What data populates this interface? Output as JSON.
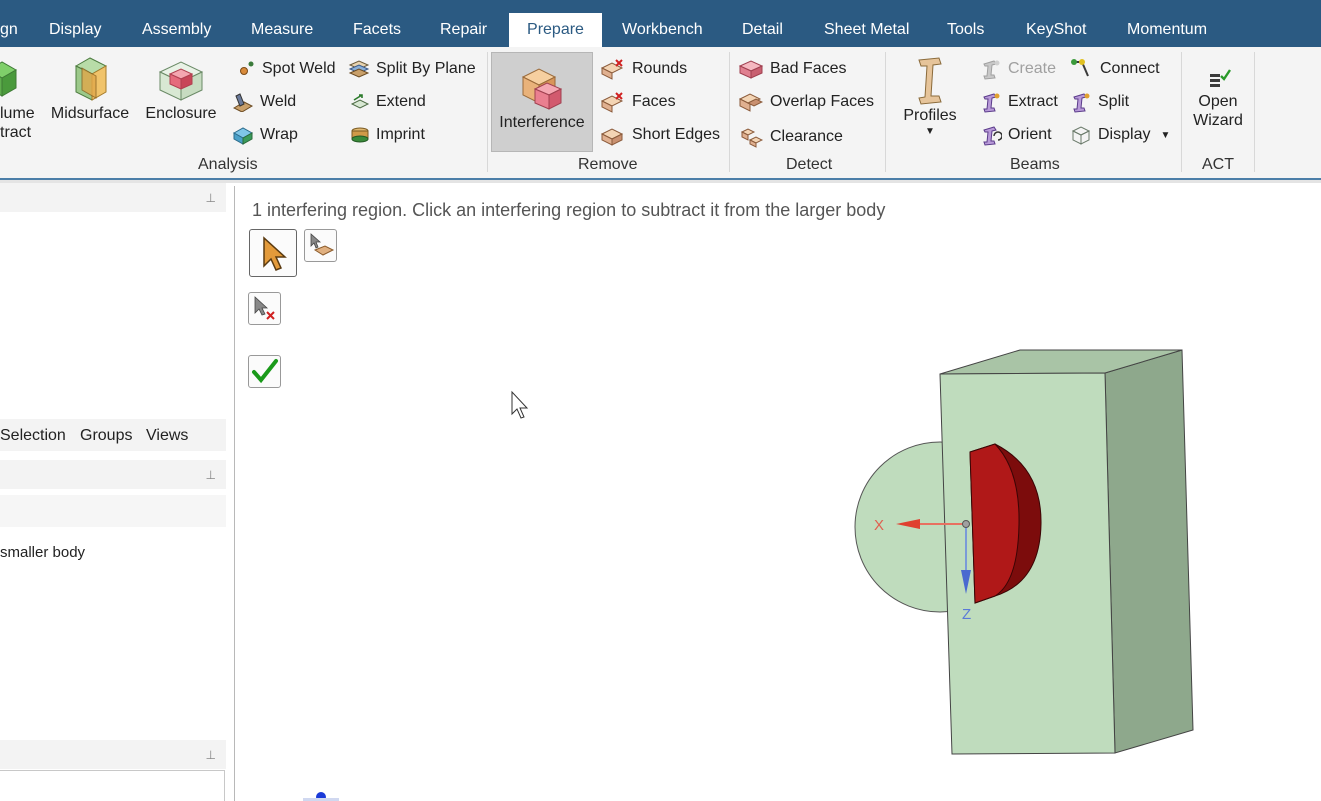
{
  "tabs": [
    {
      "label": "gn",
      "active": false
    },
    {
      "label": "Display",
      "active": false
    },
    {
      "label": "Assembly",
      "active": false
    },
    {
      "label": "Measure",
      "active": false
    },
    {
      "label": "Facets",
      "active": false
    },
    {
      "label": "Repair",
      "active": false
    },
    {
      "label": "Prepare",
      "active": true
    },
    {
      "label": "Workbench",
      "active": false
    },
    {
      "label": "Detail",
      "active": false
    },
    {
      "label": "Sheet Metal",
      "active": false
    },
    {
      "label": "Tools",
      "active": false
    },
    {
      "label": "KeyShot",
      "active": false
    },
    {
      "label": "Momentum",
      "active": false
    }
  ],
  "ribbon": {
    "analysis": {
      "label": "Analysis",
      "volume_extract_line1": "lume",
      "volume_extract_line2": "tract",
      "midsurface": "Midsurface",
      "enclosure": "Enclosure",
      "spot_weld": "Spot Weld",
      "weld": "Weld",
      "wrap": "Wrap",
      "split_by_plane": "Split By Plane",
      "extend": "Extend",
      "imprint": "Imprint"
    },
    "remove": {
      "label": "Remove",
      "interference": "Interference",
      "rounds": "Rounds",
      "faces": "Faces",
      "short_edges": "Short Edges"
    },
    "detect": {
      "label": "Detect",
      "bad_faces": "Bad Faces",
      "overlap_faces": "Overlap Faces",
      "clearance": "Clearance"
    },
    "beams": {
      "label": "Beams",
      "profiles": "Profiles",
      "create": "Create",
      "extract": "Extract",
      "orient": "Orient",
      "connect": "Connect",
      "split": "Split",
      "display": "Display"
    },
    "act": {
      "label": "ACT",
      "open_wizard_line1": "Open",
      "open_wizard_line2": "Wizard"
    }
  },
  "left_panel": {
    "tabs": [
      "Selection",
      "Groups",
      "Views"
    ],
    "option_text": "smaller body"
  },
  "viewport": {
    "hint": "1 interfering region. Click an interfering region to subtract it from the larger body",
    "axis_x": "X",
    "axis_z": "Z"
  },
  "colors": {
    "tab_bar": "#2b5a82",
    "body_green": "#bfdcbd",
    "interference_red": "#b01818"
  }
}
